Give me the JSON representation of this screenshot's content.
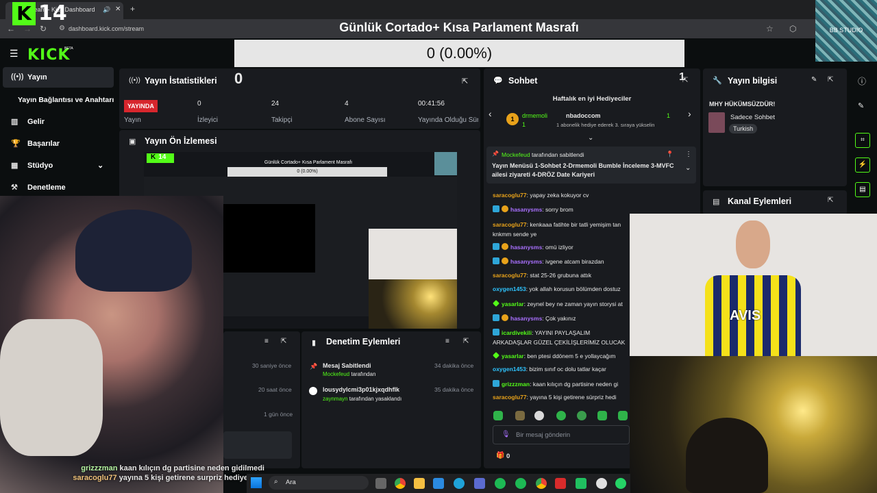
{
  "browser": {
    "tab_title": "Stream - Kick Dashboard",
    "url": "dashboard.kick.com/stream"
  },
  "overlay": {
    "logo_k": "K",
    "logo_num": "14",
    "title": "Günlük Cortado+ Kısa Parlament Masrafı",
    "progress": "0 (0.00%)",
    "studio": "BB STUDIO",
    "chat_lines": [
      {
        "user": "grizzzman",
        "text": "kaan kılıçın dg partisine neden gidilmedi"
      },
      {
        "user": "saracoglu77",
        "text": "yayına 5 kişi getirene surpriz hediye"
      }
    ]
  },
  "kick": {
    "logo": "KICK",
    "beta": "BETA"
  },
  "sidebar": {
    "items": [
      {
        "label": "Yayın"
      },
      {
        "label": "Yayın Bağlantısı ve Anahtarı"
      },
      {
        "label": "Gelir"
      },
      {
        "label": "Başarılar"
      },
      {
        "label": "Stüdyo"
      },
      {
        "label": "Denetleme"
      }
    ]
  },
  "stats": {
    "title": "Yayın İstatistikleri",
    "counter": "0",
    "live_badge": "YAYINDA",
    "status_label": "Yayın",
    "viewers": "0",
    "viewers_label": "İzleyici",
    "followers": "24",
    "followers_label": "Takipçi",
    "subs": "4",
    "subs_label": "Abone Sayısı",
    "duration": "00:41:56",
    "duration_label": "Yayında Olduğu Süre"
  },
  "preview": {
    "title": "Yayın Ön İzlemesi",
    "inner_title": "Günlük Cortado+ Kısa Parlament Masrafı",
    "inner_progress": "0 (0.00%)"
  },
  "chat": {
    "title": "Sohbet",
    "count": "1",
    "top_gifters": "Haftalık en iyi Hediyeciler",
    "gifter1": "drmemoli",
    "gifter1_count": "1",
    "gifter2": "nbadoccom",
    "gifter2_count": "1",
    "gifter2_note": "1 abonelik hediye ederek 3. sıraya yükselin",
    "pinned_by": "Mockefeud",
    "pinned_by_suffix": "tarafından sabitlendi",
    "pinned_text": "Yayın Menüsü 1-Sohbet 2-Drmemoli Bumble İnceleme 3-MVFC ailesi ziyareti 4-DRÖZ Date Kariyeri",
    "messages": [
      {
        "user": "saracoglu77",
        "text": "yapay zeka kokuyor cv",
        "color": "#e8a21a"
      },
      {
        "user": "hasanysms",
        "text": "sorry brom",
        "color": "#a970ff"
      },
      {
        "user": "saracoglu77",
        "text": "kenkaaa fatihte bir tatli yemişim tan knkmm sende ye",
        "color": "#e8a21a"
      },
      {
        "user": "hasanysms",
        "text": "omü izliyor",
        "color": "#a970ff"
      },
      {
        "user": "hasanysms",
        "text": "ivgene atcam birazdan",
        "color": "#a970ff"
      },
      {
        "user": "saracoglu77",
        "text": "stat 25-26 grubuna attık",
        "color": "#e8a21a"
      },
      {
        "user": "oxygen1453",
        "text": "yok allah korusun bölümden dostuz",
        "color": "#2ec4ff"
      },
      {
        "user": "yasarlar",
        "text": "zeynel bey ne zaman yayın storysi at",
        "color": "#53fc18"
      },
      {
        "user": "hasanysms",
        "text": "Çok yakınız",
        "color": "#a970ff"
      },
      {
        "user": "icardivekili",
        "text": "YAYINI PAYLAŞALIM ARKADAŞLAR GÜZEL ÇEKİLİŞLERİMİZ OLUCAK",
        "color": "#53fc18"
      },
      {
        "user": "yasarlar",
        "text": "ben ptesi ddönem 5 e yollaycağım",
        "color": "#53fc18"
      },
      {
        "user": "oxygen1453",
        "text": "bizim sınıf oc dolu tatlar kaçar",
        "color": "#2ec4ff"
      },
      {
        "user": "grizzzman",
        "text": "kaan kılıçın dg partisine neden gi",
        "color": "#53fc18"
      },
      {
        "user": "saracoglu77",
        "text": "yayına 5 kişi getirene sürpriz hedi",
        "color": "#e8a21a"
      }
    ],
    "input_placeholder": "Bir mesaj gönderin",
    "footer_count": "0"
  },
  "info": {
    "title": "Yayın bilgisi",
    "stream_title": "MHY HÜKÜMSÜZDÜR!",
    "category": "Sadece Sohbet",
    "language": "Turkish"
  },
  "kanal": {
    "title": "Kanal Eylemleri"
  },
  "moderation": {
    "title": "Denetim Eylemleri",
    "left_times": [
      "30 saniye önce",
      "20 saat önce",
      "1 gün önce"
    ],
    "events": [
      {
        "title": "Mesaj Sabitlendi",
        "by": "Mockefeud",
        "suffix": "tarafından",
        "time": "34 dakika önce"
      },
      {
        "title": "lousydylcmi3p01kjxqdhflk",
        "by": "zaynmayn",
        "suffix": "tarafından yasaklandı",
        "time": "35 dakika önce"
      }
    ]
  },
  "taskbar": {
    "search": "Ara"
  },
  "cams": {
    "jersey": "AVIS"
  }
}
